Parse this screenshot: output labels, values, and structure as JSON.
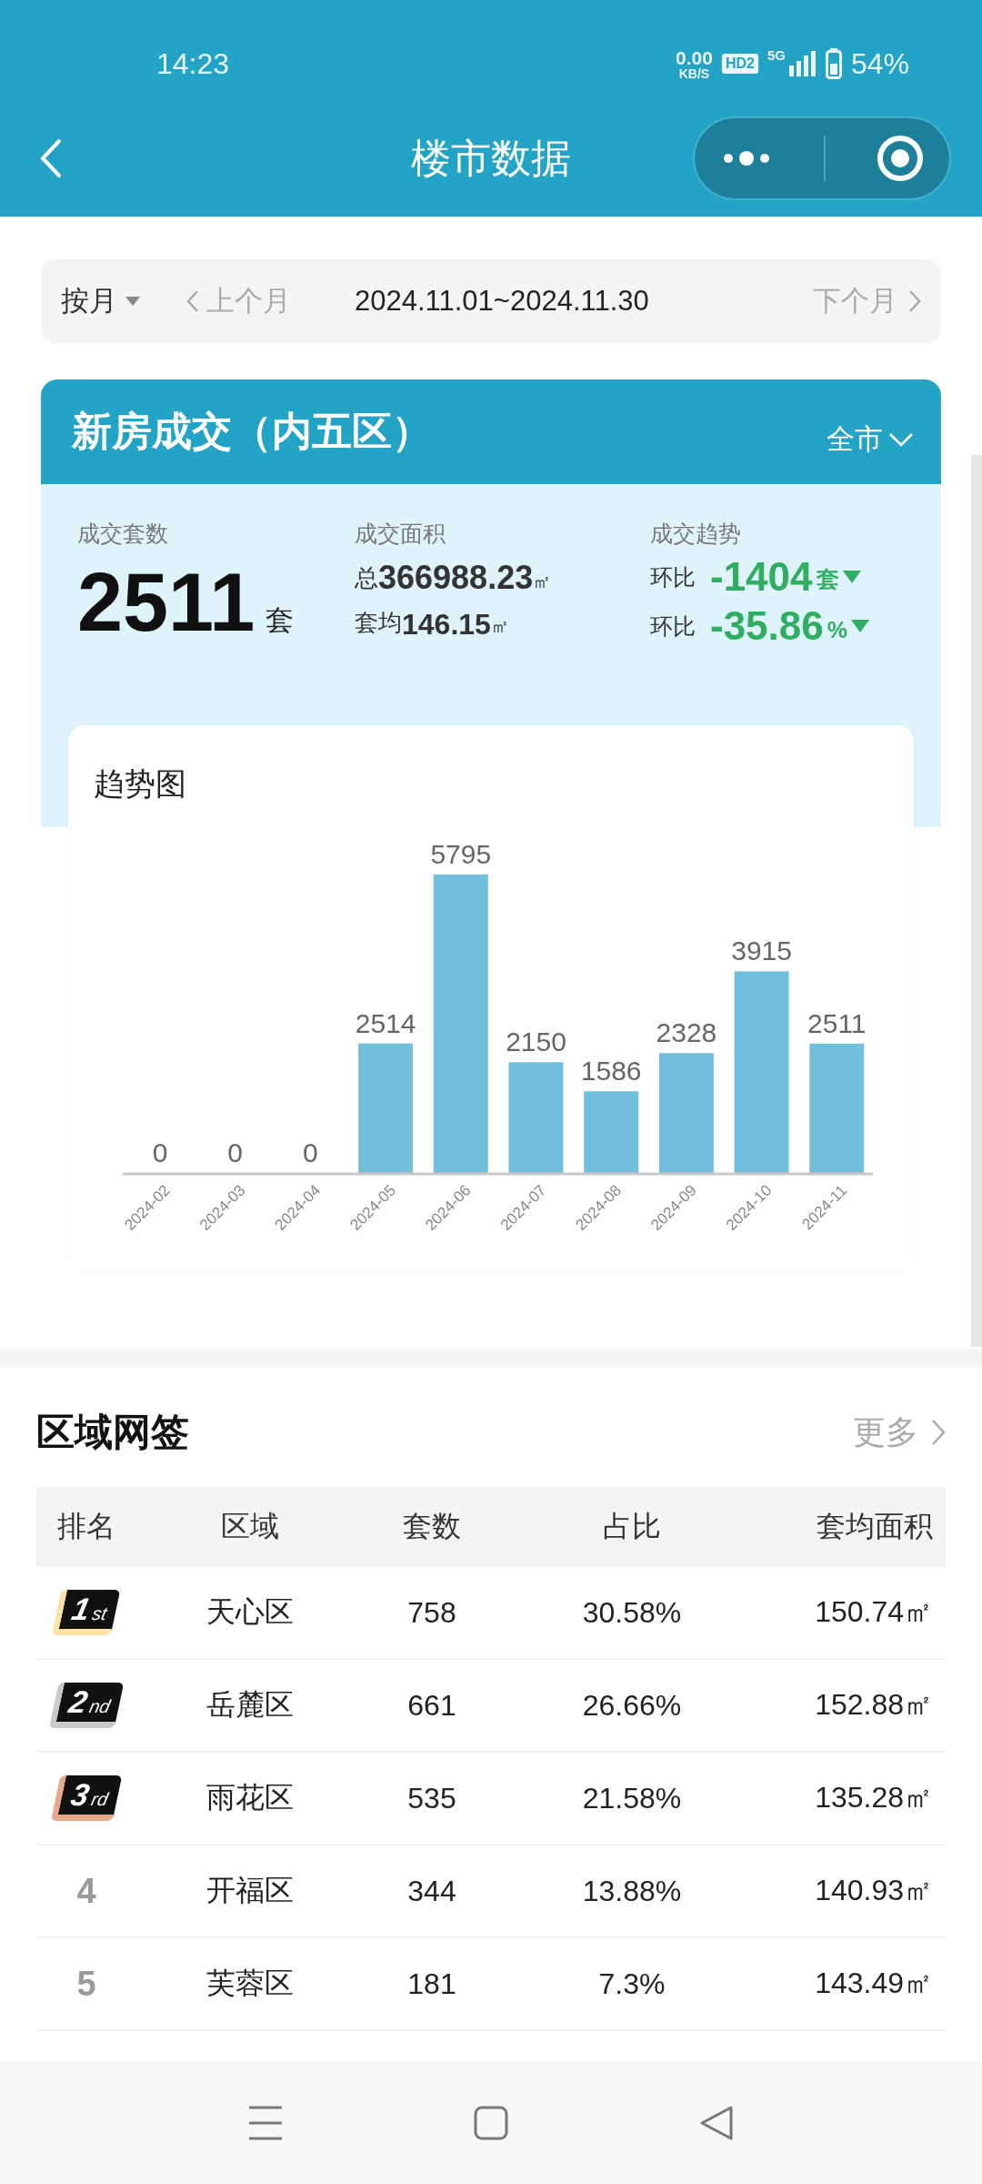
{
  "status_bar": {
    "time": "14:23",
    "net_speed": "0.00",
    "net_unit": "KB/S",
    "hd_badge": "HD2",
    "network": "5G",
    "battery": "54%"
  },
  "header": {
    "title": "楼市数据"
  },
  "period_bar": {
    "mode": "按月",
    "prev": "上个月",
    "range": "2024.11.01~2024.11.30",
    "next": "下个月"
  },
  "summary": {
    "title": "新房成交（内五区）",
    "scope": "全市",
    "units": {
      "label": "成交套数",
      "value": "2511",
      "unit": "套"
    },
    "area": {
      "label": "成交面积",
      "total_prefix": "总",
      "total": "366988.23",
      "avg_prefix": "套均",
      "avg": "146.15",
      "unit": "㎡"
    },
    "trend": {
      "label": "成交趋势",
      "items": [
        {
          "prefix": "环比",
          "value": "-1404",
          "unit": "套"
        },
        {
          "prefix": "环比",
          "value": "-35.86",
          "unit": "%"
        }
      ]
    }
  },
  "trend_chart": {
    "title": "趋势图",
    "chart_data": {
      "type": "bar",
      "categories": [
        "2024-02",
        "2024-03",
        "2024-04",
        "2024-05",
        "2024-06",
        "2024-07",
        "2024-08",
        "2024-09",
        "2024-10",
        "2024-11"
      ],
      "series": [
        {
          "color": "#72bfdd",
          "values": [
            0,
            0,
            0,
            2514,
            5795,
            2150,
            1586,
            2328,
            3915,
            2511
          ]
        }
      ],
      "data_labels": true
    }
  },
  "district": {
    "title": "区域网签",
    "more": "更多",
    "columns": [
      "排名",
      "区域",
      "套数",
      "占比",
      "套均面积"
    ],
    "rows": [
      {
        "rank": {
          "kind": "badge",
          "number": "1",
          "suffix": "st",
          "color": "#fbe3a6"
        },
        "name": "天心区",
        "units": "758",
        "share": "30.58%",
        "avg_area": "150.74㎡"
      },
      {
        "rank": {
          "kind": "badge",
          "number": "2",
          "suffix": "nd",
          "color": "#c9c9c9"
        },
        "name": "岳麓区",
        "units": "661",
        "share": "26.66%",
        "avg_area": "152.88㎡"
      },
      {
        "rank": {
          "kind": "badge",
          "number": "3",
          "suffix": "rd",
          "color": "#e8a88a"
        },
        "name": "雨花区",
        "units": "535",
        "share": "21.58%",
        "avg_area": "135.28㎡"
      },
      {
        "rank": {
          "kind": "plain",
          "number": "4"
        },
        "name": "开福区",
        "units": "344",
        "share": "13.88%",
        "avg_area": "140.93㎡"
      },
      {
        "rank": {
          "kind": "plain",
          "number": "5"
        },
        "name": "芙蓉区",
        "units": "181",
        "share": "7.3%",
        "avg_area": "143.49㎡"
      }
    ]
  }
}
